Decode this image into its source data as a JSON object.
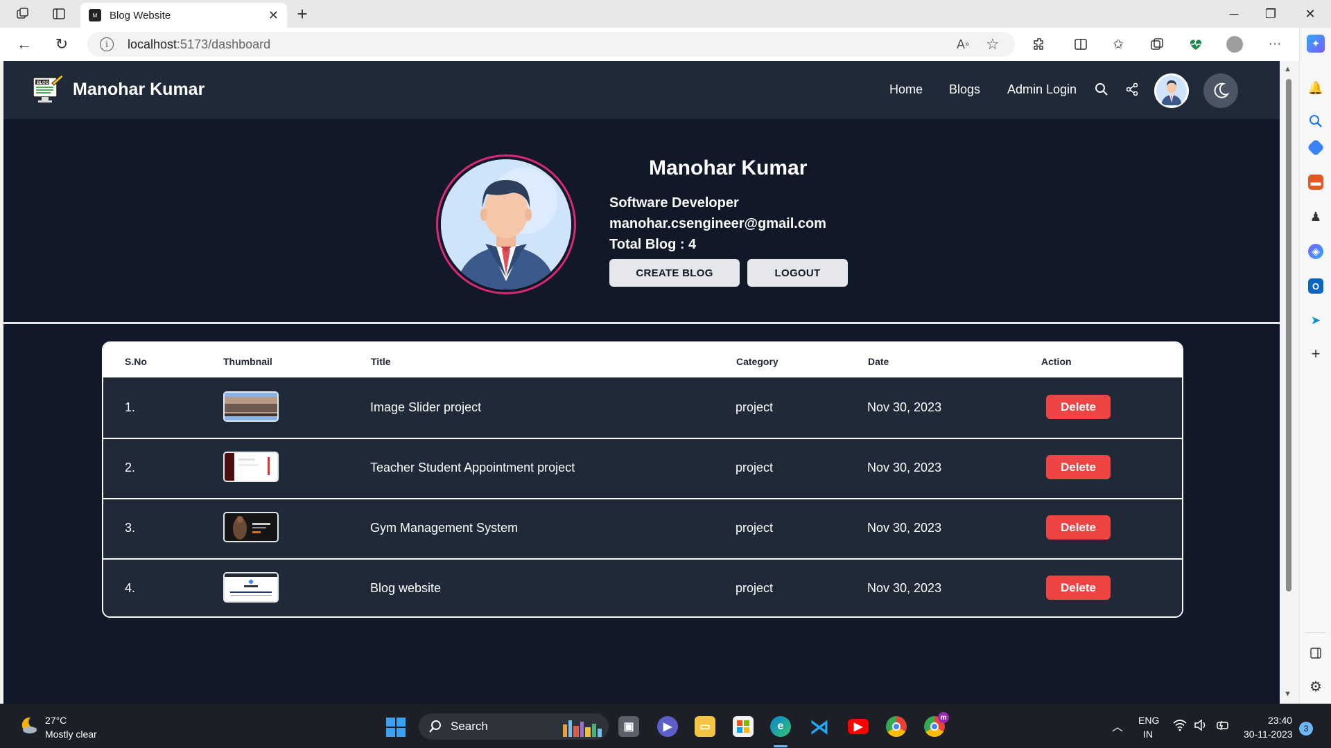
{
  "browser": {
    "tab_title": "Blog Website",
    "tab_favicon": "blog-logo",
    "url": "localhost:5173/dashboard",
    "url_host": "localhost",
    "url_path": ":5173/dashboard",
    "read_aloud_label": "A",
    "colors": {
      "accent": "#0078d4"
    }
  },
  "site": {
    "brand": "Manohar Kumar",
    "nav": {
      "home": "Home",
      "blogs": "Blogs",
      "admin_login": "Admin Login"
    },
    "logo_text": "BLOG"
  },
  "profile": {
    "name": "Manohar Kumar",
    "role": "Software Developer",
    "email": "manohar.csengineer@gmail.com",
    "total_blog": "Total Blog : 4",
    "create_blog_label": "CREATE BLOG",
    "logout_label": "LOGOUT"
  },
  "table": {
    "headers": [
      "S.No",
      "Thumbnail",
      "Title",
      "Category",
      "Date",
      "Action"
    ],
    "rows": [
      {
        "sno": "1.",
        "title": "Image Slider project",
        "category": "project",
        "date": "Nov 30, 2023",
        "action": "Delete",
        "thumb": "landscape"
      },
      {
        "sno": "2.",
        "title": "Teacher Student Appointment project",
        "category": "project",
        "date": "Nov 30, 2023",
        "action": "Delete",
        "thumb": "appointment"
      },
      {
        "sno": "3.",
        "title": "Gym Management System",
        "category": "project",
        "date": "Nov 30, 2023",
        "action": "Delete",
        "thumb": "gym"
      },
      {
        "sno": "4.",
        "title": "Blog website",
        "category": "project",
        "date": "Nov 30, 2023",
        "action": "Delete",
        "thumb": "blog"
      }
    ]
  },
  "taskbar": {
    "weather_temp": "27°C",
    "weather_desc": "Mostly clear",
    "search_label": "Search",
    "lang_top": "ENG",
    "lang_bottom": "IN",
    "time": "23:40",
    "date": "30-11-2023",
    "notification_count": "3",
    "chrome_profile_letter": "m"
  }
}
